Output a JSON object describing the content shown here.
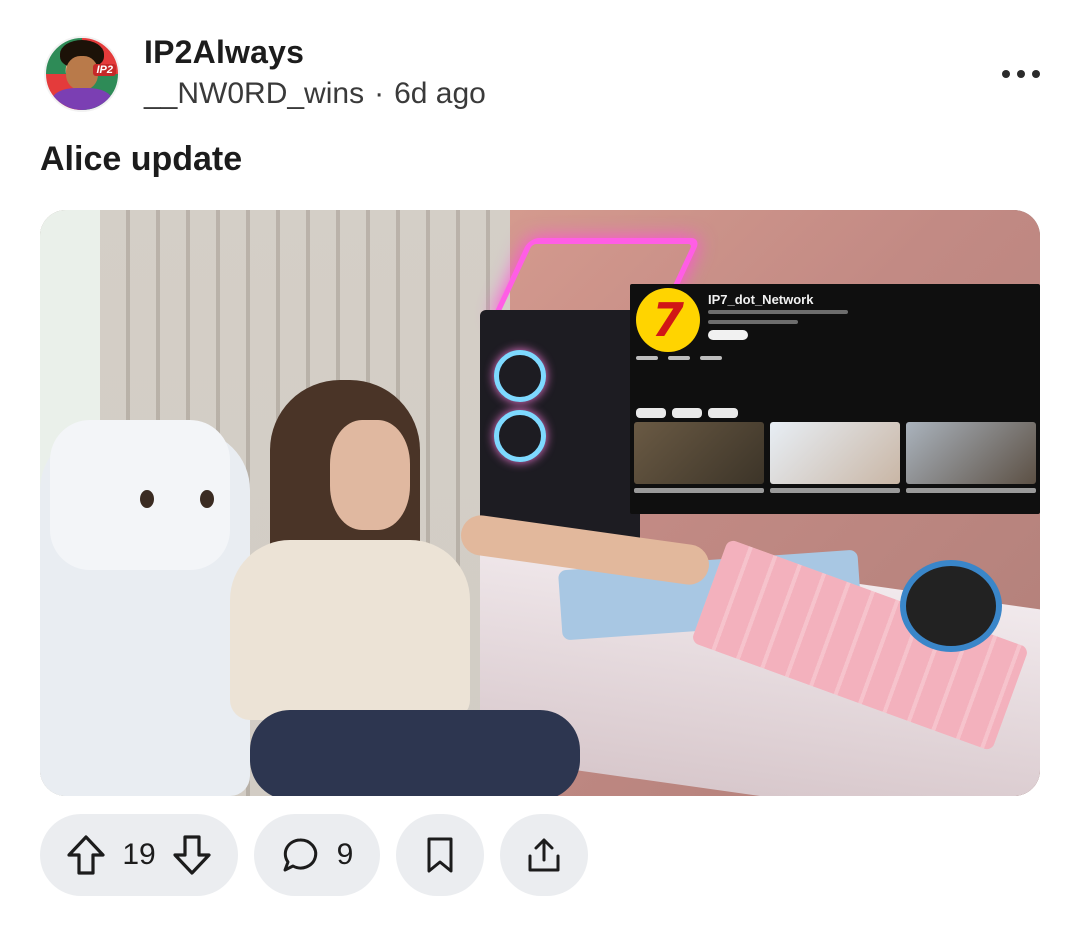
{
  "post": {
    "community": "IP2Always",
    "author": "__NW0RD_wins",
    "separator": "·",
    "age": "6d ago",
    "title": "Alice update"
  },
  "avatar": {
    "badge_text": "IP2"
  },
  "embedded_screenshot": {
    "channel_name": "IP7_dot_Network",
    "logo_number": "7"
  },
  "actions": {
    "score": "19",
    "comments": "9"
  },
  "icons": {
    "more": "more-icon",
    "upvote": "upvote-icon",
    "downvote": "downvote-icon",
    "comment": "comment-icon",
    "save": "bookmark-icon",
    "share": "share-icon"
  }
}
